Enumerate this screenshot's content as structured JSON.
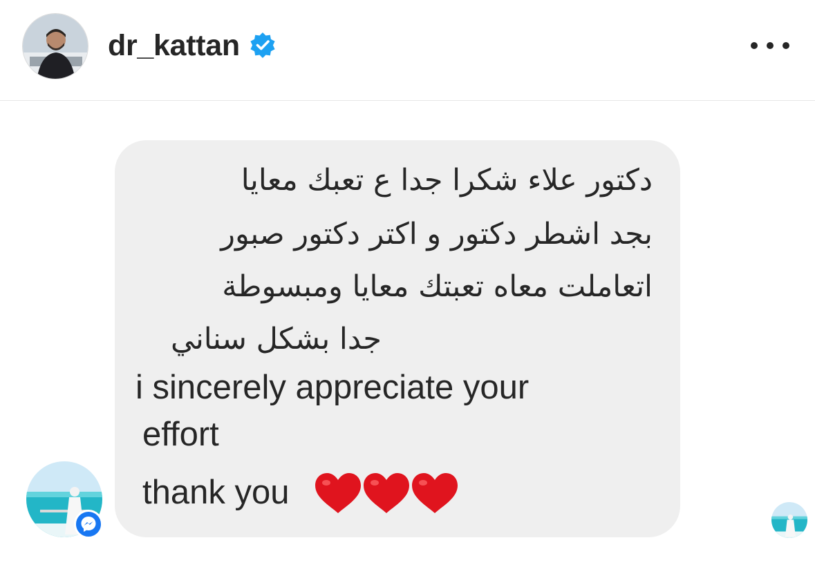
{
  "header": {
    "username": "dr_kattan",
    "verified": true,
    "avatar_icon": "profile-photo-icon",
    "more_icon": "more-options-icon"
  },
  "message": {
    "arabic_lines": [
      "دكتور علاء شكرا جدا ع تعبك معايا",
      "بجد اشطر دكتور و اكتر دكتور صبور",
      "اتعاملت معاه تعبتك معايا ومبسوطة",
      "جدا بشكل سناني"
    ],
    "english_lines": [
      " i sincerely appreciate your",
      "effort",
      "thank you"
    ],
    "emoji": [
      "red-heart",
      "red-heart",
      "red-heart"
    ]
  },
  "colors": {
    "bubble_bg": "#efefef",
    "verified_blue": "#1da1f2",
    "messenger_blue": "#1877f2",
    "heart_red": "#e0141e"
  }
}
